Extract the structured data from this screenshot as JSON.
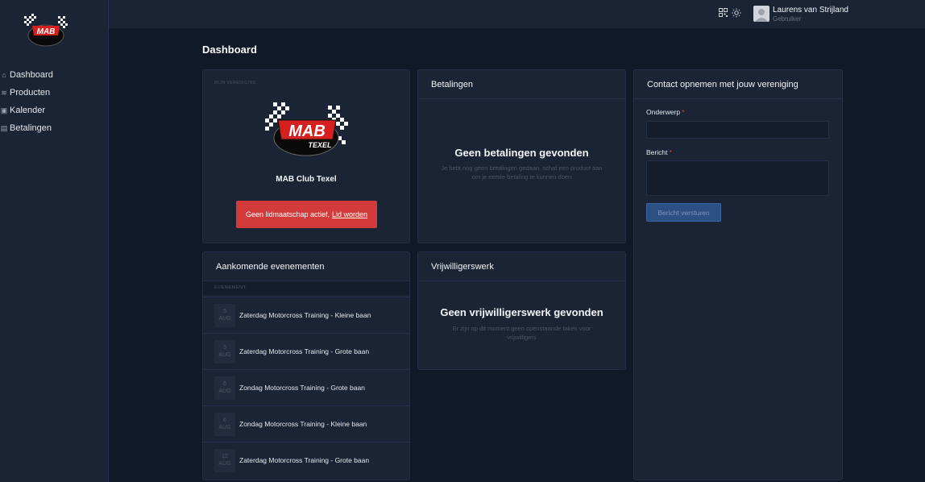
{
  "sidebar": {
    "items": [
      {
        "label": "Dashboard",
        "icon": "home-icon"
      },
      {
        "label": "Producten",
        "icon": "box-icon"
      },
      {
        "label": "Kalender",
        "icon": "calendar-icon"
      },
      {
        "label": "Betalingen",
        "icon": "receipt-icon"
      }
    ]
  },
  "header": {
    "user_name": "Laurens van Strijland",
    "user_role": "Gebruiker"
  },
  "page_title": "Dashboard",
  "club": {
    "section_label": "MIJN VERENIGING",
    "name": "MAB Club Texel",
    "membership_text": "Geen lidmaatschap actief,",
    "membership_link": "Lid worden"
  },
  "payments": {
    "title": "Betalingen",
    "empty_title": "Geen betalingen gevonden",
    "empty_text": "Je hebt nog geen betalingen gedaan, schaf een product aan om je eerste betaling te kunnen doen"
  },
  "events": {
    "title": "Aankomende evenementen",
    "column": "EVENEMENT",
    "rows": [
      {
        "day": "5",
        "month": "AUG",
        "name": "Zaterdag Motorcross Training - Kleine baan"
      },
      {
        "day": "5",
        "month": "AUG",
        "name": "Zaterdag Motorcross Training - Grote baan"
      },
      {
        "day": "6",
        "month": "AUG",
        "name": "Zondag Motorcross Training - Grote baan"
      },
      {
        "day": "6",
        "month": "AUG",
        "name": "Zondag Motorcross Training - Kleine baan"
      },
      {
        "day": "12",
        "month": "AUG",
        "name": "Zaterdag Motorcross Training - Grote baan"
      }
    ]
  },
  "volunteer": {
    "title": "Vrijwilligerswerk",
    "empty_title": "Geen vrijwilligerswerk gevonden",
    "empty_text": "Er zijn op dit moment geen openstaande taken voor vrijwilligers"
  },
  "contact": {
    "title": "Contact opnemen met jouw vereniging",
    "subject_label": "Onderwerp",
    "subject_value": "",
    "message_label": "Bericht",
    "message_value": "",
    "required_mark": "*",
    "submit_label": "Bericht versturen"
  },
  "colors": {
    "background": "#111827",
    "card": "#1b2435",
    "danger": "#d33b3b",
    "primary": "#2c4f84"
  }
}
